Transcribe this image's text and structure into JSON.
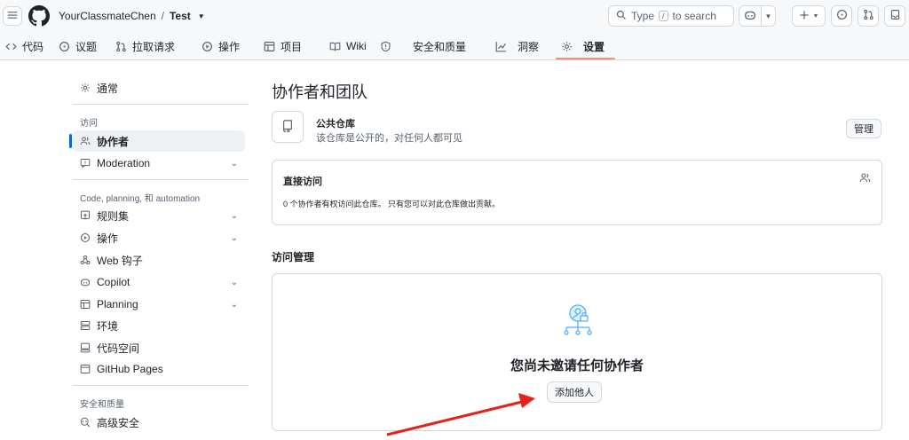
{
  "header": {
    "repo_owner": "YourClassmateChen",
    "separator": "/",
    "repo_name": "Test",
    "search_text": "Type",
    "search_key": "/",
    "search_suffix": "to search"
  },
  "tabs": [
    {
      "label": "代码",
      "icon": "code-icon"
    },
    {
      "label": "议题",
      "icon": "issue-icon"
    },
    {
      "label": "拉取请求",
      "icon": "pull-request-icon"
    },
    {
      "label": "操作",
      "icon": "play-icon"
    },
    {
      "label": "项目",
      "icon": "table-icon"
    },
    {
      "label": "Wiki",
      "icon": "book-icon"
    },
    {
      "label": "安全和质量",
      "icon": "shield-icon"
    },
    {
      "label": "洞察",
      "icon": "graph-icon"
    },
    {
      "label": "设置",
      "icon": "gear-icon"
    }
  ],
  "sidebar": {
    "general": "通常",
    "access_heading": "访问",
    "collaborators": "协作者",
    "moderation": "Moderation",
    "code_heading": "Code, planning, 和 automation",
    "rules": "规则集",
    "actions": "操作",
    "webhooks": "Web 钩子",
    "copilot": "Copilot",
    "planning": "Planning",
    "environments": "环境",
    "codespaces": "代码空间",
    "pages": "GitHub Pages",
    "security_heading": "安全和质量",
    "advanced_security": "高级安全"
  },
  "main": {
    "title": "协作者和团队",
    "public_title": "公共仓库",
    "public_desc": "该仓库是公开的，对任何人都可见",
    "manage_label": "管理",
    "direct_title": "直接访问",
    "direct_desc": "0 个协作者有权访问此仓库。 只有您可以对此仓库做出贡献。",
    "access_heading": "访问管理",
    "empty_title": "您尚未邀请任何协作者",
    "add_label": "添加他人"
  },
  "colors": {
    "accent": "#0969da",
    "tab_underline": "#fd8c73",
    "annotation_arrow": "#e3231b"
  }
}
